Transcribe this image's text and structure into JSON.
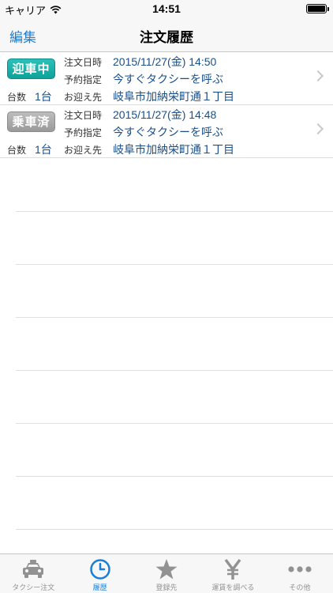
{
  "status_bar": {
    "carrier": "キャリア",
    "time": "14:51"
  },
  "nav": {
    "edit_label": "編集",
    "title": "注文履歴"
  },
  "labels": {
    "count": "台数",
    "order_time": "注文日時",
    "reservation": "予約指定",
    "pickup": "お迎え先"
  },
  "orders": [
    {
      "status": "迎車中",
      "status_kind": "active",
      "count": "1台",
      "order_time": "2015/11/27(金) 14:50",
      "reservation": "今すぐタクシーを呼ぶ",
      "pickup": "岐阜市加納栄町通１丁目"
    },
    {
      "status": "乗車済",
      "status_kind": "done",
      "count": "1台",
      "order_time": "2015/11/27(金) 14:48",
      "reservation": "今すぐタクシーを呼ぶ",
      "pickup": "岐阜市加納栄町通１丁目"
    }
  ],
  "tabs": [
    {
      "label": "タクシー注文",
      "icon": "taxi-icon",
      "selected": false
    },
    {
      "label": "履歴",
      "icon": "clock-icon",
      "selected": true
    },
    {
      "label": "登録先",
      "icon": "star-icon",
      "selected": false
    },
    {
      "label": "運賃を調べる",
      "icon": "yen-icon",
      "selected": false
    },
    {
      "label": "その他",
      "icon": "more-icon",
      "selected": false
    }
  ],
  "colors": {
    "accent": "#1a7fd4",
    "active_badge": "#15aaa3",
    "done_badge": "#a8a8a8",
    "inactive_tab": "#929292"
  }
}
